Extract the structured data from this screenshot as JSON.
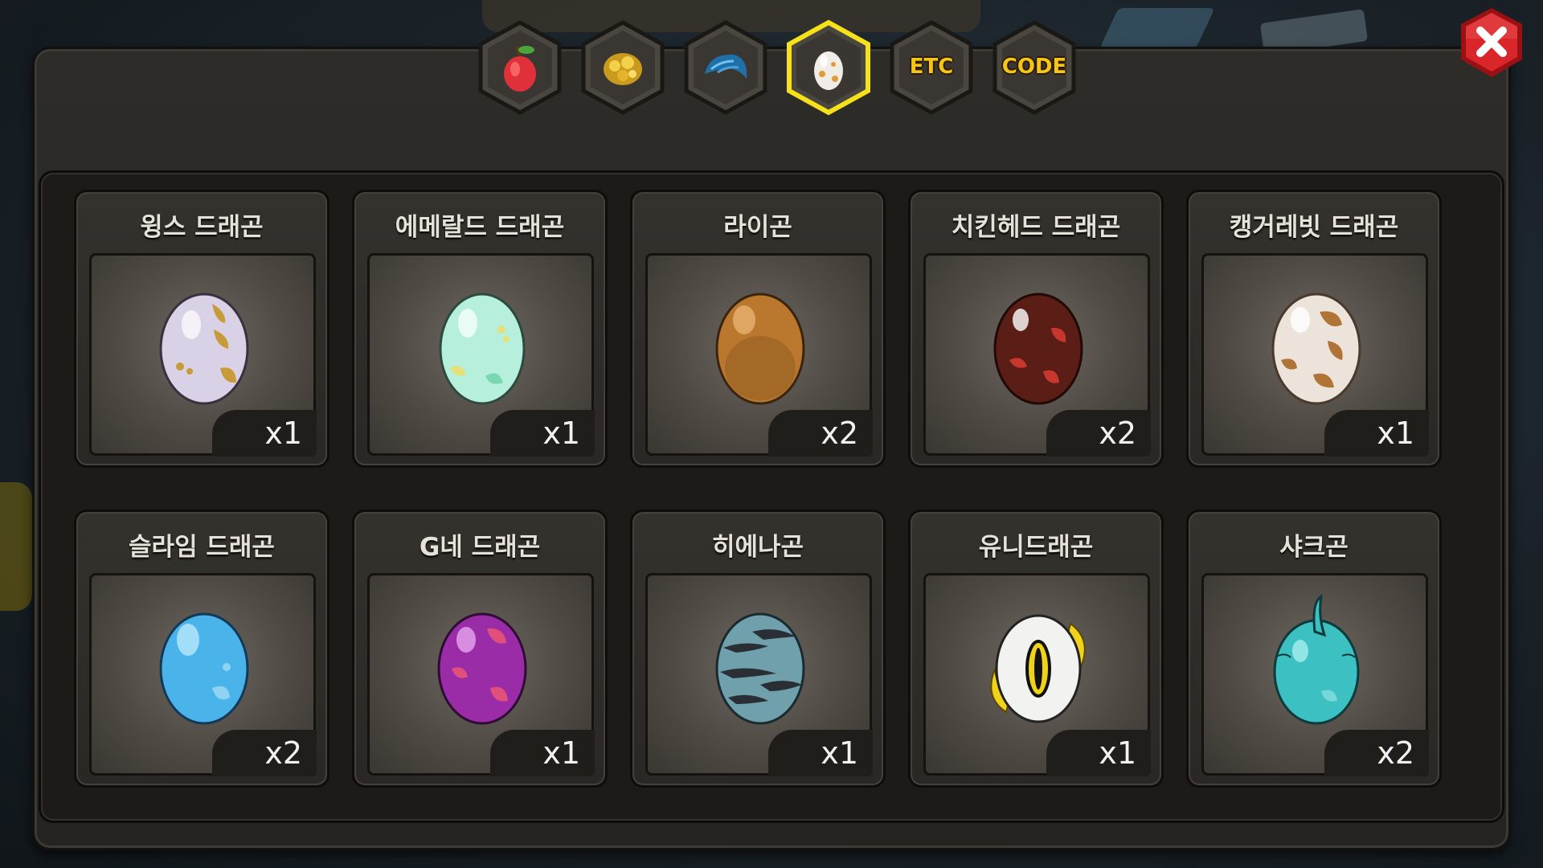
{
  "tabs": [
    {
      "id": "fruit",
      "icon": "fruit-icon",
      "label": "",
      "selected": false
    },
    {
      "id": "gold",
      "icon": "gold-ore-icon",
      "label": "",
      "selected": false
    },
    {
      "id": "scale",
      "icon": "dragon-scale-icon",
      "label": "",
      "selected": false
    },
    {
      "id": "egg",
      "icon": "egg-icon",
      "label": "",
      "selected": true
    },
    {
      "id": "etc",
      "icon": "",
      "label": "ETC",
      "selected": false
    },
    {
      "id": "code",
      "icon": "",
      "label": "CODE",
      "selected": false
    }
  ],
  "colors": {
    "selected_tab_border": "#f5e21a",
    "close_button": "#d8262a",
    "tab_label": "#f5c518"
  },
  "items": [
    {
      "name": "윙스 드래곤",
      "quantity": "x1",
      "egg": {
        "base": "#d9d2e6",
        "spots": "#c79a3a",
        "icon": "wings-dragon-egg-icon"
      }
    },
    {
      "name": "에메랄드 드래곤",
      "quantity": "x1",
      "egg": {
        "base": "#b6f0dc",
        "spots": "#e6e07a",
        "icon": "emerald-dragon-egg-icon"
      }
    },
    {
      "name": "라이곤",
      "quantity": "x2",
      "egg": {
        "base": "#b9782e",
        "spots": "#b9782e",
        "icon": "raigon-egg-icon"
      }
    },
    {
      "name": "치킨헤드 드래곤",
      "quantity": "x2",
      "egg": {
        "base": "#5a1e16",
        "spots": "#c8372c",
        "icon": "chickenhead-dragon-egg-icon"
      }
    },
    {
      "name": "캥거레빗 드래곤",
      "quantity": "x1",
      "egg": {
        "base": "#ece3da",
        "spots": "#b07436",
        "icon": "kangarabbit-dragon-egg-icon"
      }
    },
    {
      "name": "슬라임 드래곤",
      "quantity": "x2",
      "egg": {
        "base": "#4ab4ea",
        "spots": "#8fd3f2",
        "icon": "slime-dragon-egg-icon"
      }
    },
    {
      "name": "G네 드래곤",
      "quantity": "x1",
      "egg": {
        "base": "#9a2ca8",
        "spots": "#e0507a",
        "icon": "g-dragon-egg-icon"
      }
    },
    {
      "name": "히에나곤",
      "quantity": "x1",
      "egg": {
        "base": "#6fa0ab",
        "spots": "#2a2f36",
        "icon": "hyenagon-egg-icon"
      }
    },
    {
      "name": "유니드래곤",
      "quantity": "x1",
      "egg": {
        "base": "#f2f2f0",
        "spots": "#f0d21a",
        "icon": "uni-dragon-egg-icon"
      }
    },
    {
      "name": "샤크곤",
      "quantity": "x2",
      "egg": {
        "base": "#3cc0c2",
        "spots": "#76d8d8",
        "icon": "sharkgon-egg-icon"
      }
    }
  ]
}
